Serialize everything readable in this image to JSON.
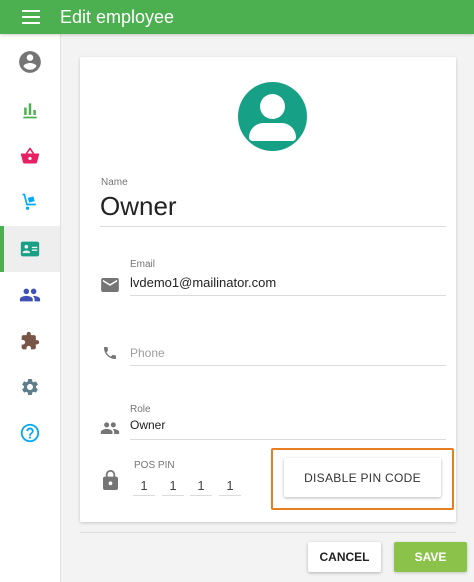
{
  "header": {
    "title": "Edit employee",
    "menu_icon": "hamburger-menu-icon"
  },
  "sidebar": {
    "items": [
      {
        "icon": "account-circle-icon",
        "color": "#757575"
      },
      {
        "icon": "bar-chart-icon",
        "color": "#4caf50"
      },
      {
        "icon": "shopping-basket-icon",
        "color": "#e91e63"
      },
      {
        "icon": "dolly-icon",
        "color": "#03a9f4"
      },
      {
        "icon": "badge-icon",
        "color": "#16a085",
        "active": true
      },
      {
        "icon": "people-icon",
        "color": "#3f51b5"
      },
      {
        "icon": "puzzle-icon",
        "color": "#795548"
      },
      {
        "icon": "settings-icon",
        "color": "#607d8b"
      },
      {
        "icon": "help-icon",
        "color": "#03a9f4"
      }
    ]
  },
  "form": {
    "avatar_color": "#16a085",
    "name_label": "Name",
    "name_value": "Owner",
    "email_label": "Email",
    "email_value": "lvdemo1@mailinator.com",
    "phone_placeholder": "Phone",
    "role_label": "Role",
    "role_value": "Owner",
    "pin_label": "POS PIN",
    "pin_digits": [
      "1",
      "1",
      "1",
      "1"
    ],
    "disable_pin_label": "DISABLE PIN CODE"
  },
  "actions": {
    "cancel_label": "CANCEL",
    "save_label": "SAVE"
  },
  "colors": {
    "primary": "#4caf50",
    "save": "#8bc34a",
    "highlight": "#e67e22"
  }
}
